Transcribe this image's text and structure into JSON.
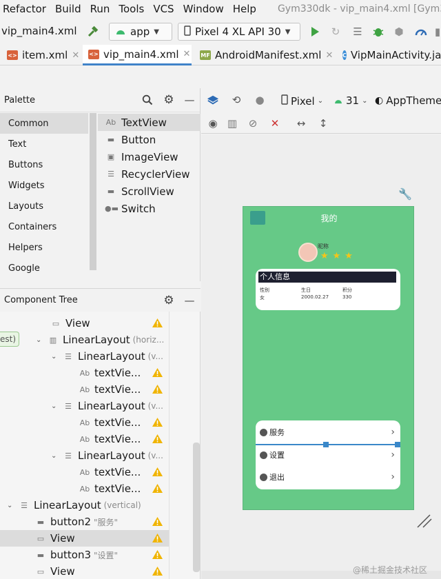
{
  "menubar": {
    "items": [
      "Refactor",
      "Build",
      "Run",
      "Tools",
      "VCS",
      "Window",
      "Help"
    ],
    "window_title": "Gym330dk - vip_main4.xml [Gym3"
  },
  "toolbar": {
    "breadcrumb_file": "vip_main4.xml",
    "module": "app",
    "device": "Pixel 4 XL API 30"
  },
  "tabs": [
    {
      "label": "item.xml",
      "badge": "<>"
    },
    {
      "label": "vip_main4.xml",
      "badge": "<>"
    },
    {
      "label": "AndroidManifest.xml",
      "badge": "MF"
    },
    {
      "label": "VipMainActivity.ja",
      "badge": "C"
    }
  ],
  "palette": {
    "title": "Palette",
    "categories": [
      "Common",
      "Text",
      "Buttons",
      "Widgets",
      "Layouts",
      "Containers",
      "Helpers",
      "Google"
    ],
    "items": [
      {
        "label": "TextView",
        "glyph": "Ab"
      },
      {
        "label": "Button",
        "glyph": "▬"
      },
      {
        "label": "ImageView",
        "glyph": "▣"
      },
      {
        "label": "RecyclerView",
        "glyph": "☰"
      },
      {
        "label": "ScrollView",
        "glyph": "▬"
      },
      {
        "label": "Switch",
        "glyph": "●▬"
      }
    ]
  },
  "component_tree": {
    "title": "Component Tree",
    "side_label": "est)",
    "rows": [
      {
        "label": "View",
        "sub": "",
        "glyph": "▭",
        "warn": true
      },
      {
        "label": "LinearLayout",
        "sub": "(horiz...",
        "glyph": "▥",
        "warn": false
      },
      {
        "label": "LinearLayout",
        "sub": "(v...",
        "glyph": "☰",
        "warn": false
      },
      {
        "label": "textVie...",
        "sub": "",
        "glyph": "Ab",
        "warn": true
      },
      {
        "label": "textVie...",
        "sub": "",
        "glyph": "Ab",
        "warn": true
      },
      {
        "label": "LinearLayout",
        "sub": "(v...",
        "glyph": "☰",
        "warn": false
      },
      {
        "label": "textVie...",
        "sub": "",
        "glyph": "Ab",
        "warn": true
      },
      {
        "label": "textVie...",
        "sub": "",
        "glyph": "Ab",
        "warn": true
      },
      {
        "label": "LinearLayout",
        "sub": "(v...",
        "glyph": "☰",
        "warn": false
      },
      {
        "label": "textVie...",
        "sub": "",
        "glyph": "Ab",
        "warn": true
      },
      {
        "label": "textVie...",
        "sub": "",
        "glyph": "Ab",
        "warn": true
      },
      {
        "label": "LinearLayout",
        "sub": "(vertical)",
        "glyph": "☰",
        "warn": false
      },
      {
        "label": "button2",
        "sub": "\"服务\"",
        "glyph": "▬",
        "warn": true
      },
      {
        "label": "View",
        "sub": "",
        "glyph": "▭",
        "warn": true
      },
      {
        "label": "button3",
        "sub": "\"设置\"",
        "glyph": "▬",
        "warn": true
      },
      {
        "label": "View",
        "sub": "",
        "glyph": "▭",
        "warn": true
      }
    ]
  },
  "design_toolbar": {
    "device": "Pixel",
    "api": "31",
    "theme": "AppTheme"
  },
  "phone": {
    "title": "我的",
    "username": "昵称",
    "info_title": "个人信息",
    "info_cols": [
      {
        "head": "性别",
        "value": "女"
      },
      {
        "head": "生日",
        "value": "2000.02.27"
      },
      {
        "head": "积分",
        "value": "330"
      }
    ],
    "options": [
      "服务",
      "设置",
      "退出"
    ]
  },
  "watermark": "@稀土掘金技术社区",
  "colors": {
    "phone_bg": "#66c987",
    "accent": "#4083c9",
    "warning": "#f0b400",
    "run_green": "#3fa343",
    "info_title_bg": "#1e2030"
  }
}
